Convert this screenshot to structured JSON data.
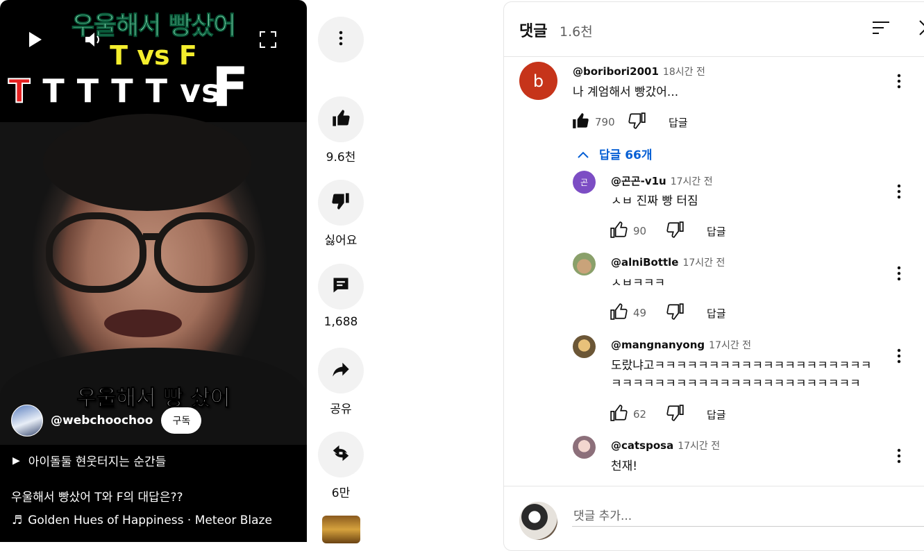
{
  "video": {
    "overlay_line1": "우울해서 빵샀어",
    "overlay_line2": "T vs F",
    "overlay_line3_red": "T",
    "overlay_line3": "T T T T vs",
    "overlay_big_f": "F",
    "caption": "우울해서 빵 샀어",
    "channel_handle": "@webchoochoo",
    "subscribe_label": "구독",
    "playlist_label": "아이돌둘 현웃터지는 순간들",
    "title": "우울해서 빵샀어 T와 F의 대답은??",
    "music": "Golden Hues of Happiness · Meteor Blaze"
  },
  "actions": {
    "like_count": "9.6천",
    "dislike_label": "싫어요",
    "comment_count": "1,688",
    "share_label": "공유",
    "remix_count": "6만"
  },
  "comments_panel": {
    "title": "댓글",
    "count": "1.6천",
    "add_placeholder": "댓글 추가...",
    "top_comment": {
      "avatar_letter": "b",
      "author": "@boribori2001",
      "time": "18시간 전",
      "text": "나 계엄해서 빵갔어...",
      "likes": "790",
      "reply_label": "답글"
    },
    "replies_toggle": "답글 66개",
    "replies": [
      {
        "author": "@곤곤-v1u",
        "avatar_letter": "곤",
        "time": "17시간 전",
        "text": "ㅅㅂ 진짜 빵 터짐",
        "likes": "90",
        "reply_label": "답글"
      },
      {
        "author": "@alniBottle",
        "time": "17시간 전",
        "text": "ㅅㅂㅋㅋㅋ",
        "likes": "49",
        "reply_label": "답글"
      },
      {
        "author": "@mangnanyong",
        "time": "17시간 전",
        "text_line1": "도랐냐고ㅋㅋㅋㅋㅋㅋㅋㅋㅋㅋㅋㅋㅋㅋㅋㅋㅋㅋㅋㅋ",
        "text_line2": "ㅋㅋㅋㅋㅋㅋㅋㅋㅋㅋㅋㅋㅋㅋㅋㅋㅋㅋㅋㅋㅋㅋㅋ",
        "likes": "62",
        "reply_label": "답글"
      },
      {
        "author": "@catsposa",
        "time": "17시간 전",
        "text": "천재!"
      }
    ]
  },
  "colors": {
    "link_blue": "#065fd4",
    "top_avatar": "#c6341a",
    "reply_avatar": "#7c4dc4"
  }
}
